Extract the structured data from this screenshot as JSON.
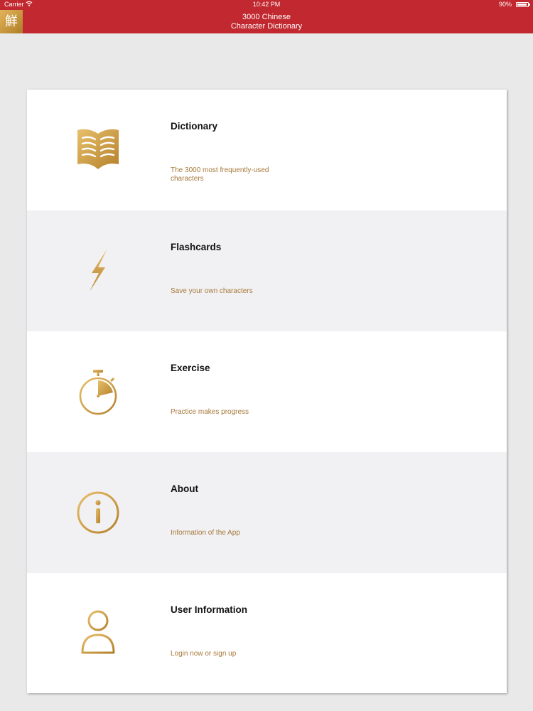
{
  "status_bar": {
    "carrier": "Carrier",
    "time": "10:42 PM",
    "battery": "90%",
    "battery_level": 0.9
  },
  "header": {
    "logo_glyph": "鮮",
    "title_line1": "3000 Chinese",
    "title_line2": "Character Dictionary",
    "background_color": "#c1282f",
    "accent_gold": "#c99a44"
  },
  "menu": [
    {
      "title": "Dictionary",
      "subtitle": "The 3000 most frequently-used characters",
      "icon": "open-book-icon"
    },
    {
      "title": "Flashcards",
      "subtitle": "Save your own characters",
      "icon": "lightning-bolt-icon"
    },
    {
      "title": "Exercise",
      "subtitle": "Practice makes progress",
      "icon": "stopwatch-icon"
    },
    {
      "title": "About",
      "subtitle": "Information of the App",
      "icon": "info-icon"
    },
    {
      "title": "User Information",
      "subtitle": "Login now or sign up",
      "icon": "user-icon"
    }
  ]
}
